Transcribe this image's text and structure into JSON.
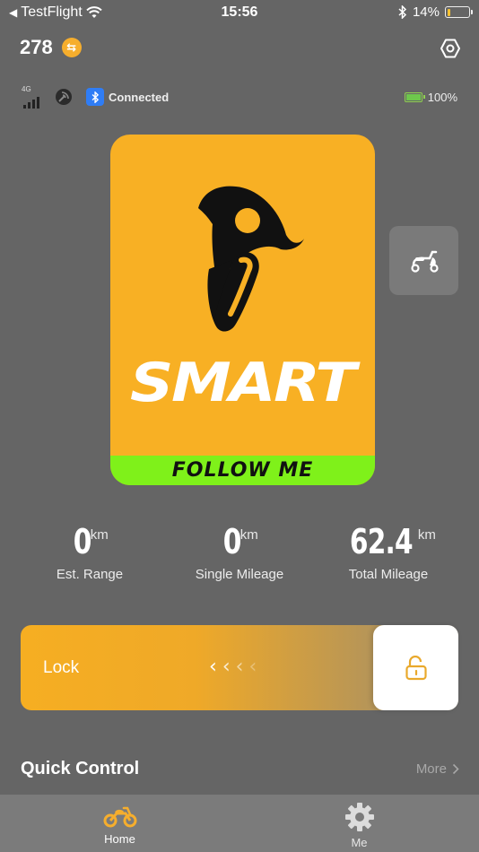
{
  "status_bar": {
    "back_app": "TestFlight",
    "time": "15:56",
    "battery_percent": "14%",
    "battery_level": 0.14
  },
  "header": {
    "points": "278",
    "points_icon": "exchange-coin-icon",
    "settings_icon": "hexagon-settings-icon"
  },
  "connection": {
    "network_label": "4G",
    "bluetooth_status": "Connected",
    "vehicle_battery": "100%",
    "vehicle_battery_level": 1.0
  },
  "vehicle_card": {
    "brand": "SMART",
    "tagline": "FOLLOW ME",
    "colors": {
      "card": "#f8b024",
      "footer": "#7ff11a"
    }
  },
  "stats": [
    {
      "value": "0",
      "unit": "km",
      "label": "Est. Range"
    },
    {
      "value": "0",
      "unit": "km",
      "label": "Single Mileage"
    },
    {
      "value": "62.4",
      "unit": "km",
      "label": "Total Mileage"
    }
  ],
  "lock_slider": {
    "label": "Lock",
    "chevrons": [
      "‹",
      "‹",
      "‹",
      "‹"
    ],
    "knob_icon": "unlocked-padlock-icon"
  },
  "quick_control": {
    "title": "Quick Control",
    "more": "More"
  },
  "tabs": [
    {
      "label": "Home",
      "icon": "motorcycle-icon",
      "active": true
    },
    {
      "label": "Me",
      "icon": "gear-icon",
      "active": false
    }
  ],
  "accent_color": "#f6ae2d"
}
